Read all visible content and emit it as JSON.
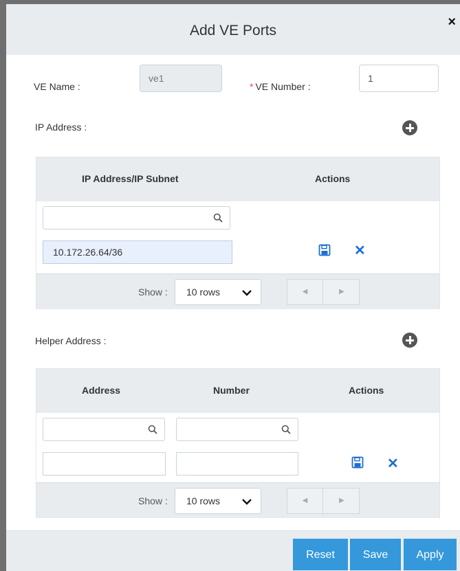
{
  "dialog": {
    "title": "Add VE Ports",
    "close_glyph": "×"
  },
  "form": {
    "ve_name_label": "VE Name :",
    "ve_name_value": "ve1",
    "ve_number_required": "*",
    "ve_number_label": "VE Number :",
    "ve_number_value": "1"
  },
  "ip_section": {
    "label": "IP Address :",
    "table": {
      "columns": [
        "IP Address/IP Subnet",
        "Actions"
      ],
      "search_placeholder": "",
      "row_value": "10.172.26.64/36",
      "show_label": "Show :",
      "rows_option": "10 rows"
    }
  },
  "helper_section": {
    "label": "Helper Address :",
    "table": {
      "columns": [
        "Address",
        "Number",
        "Actions"
      ],
      "address_value": "",
      "number_value": "",
      "show_label": "Show :",
      "rows_option": "10 rows"
    }
  },
  "pager": {
    "prev_glyph": "◀",
    "next_glyph": "▶"
  },
  "buttons": {
    "reset": "Reset",
    "save": "Save",
    "apply": "Apply"
  },
  "colors": {
    "primary": "#3498db",
    "action_icon": "#1b6fd1",
    "required": "#e24a4a"
  },
  "icons": {
    "add": "plus-circle-icon",
    "search": "search-icon",
    "save": "floppy-disk-icon",
    "delete": "close-x-icon",
    "dropdown": "chevron-down-icon"
  }
}
